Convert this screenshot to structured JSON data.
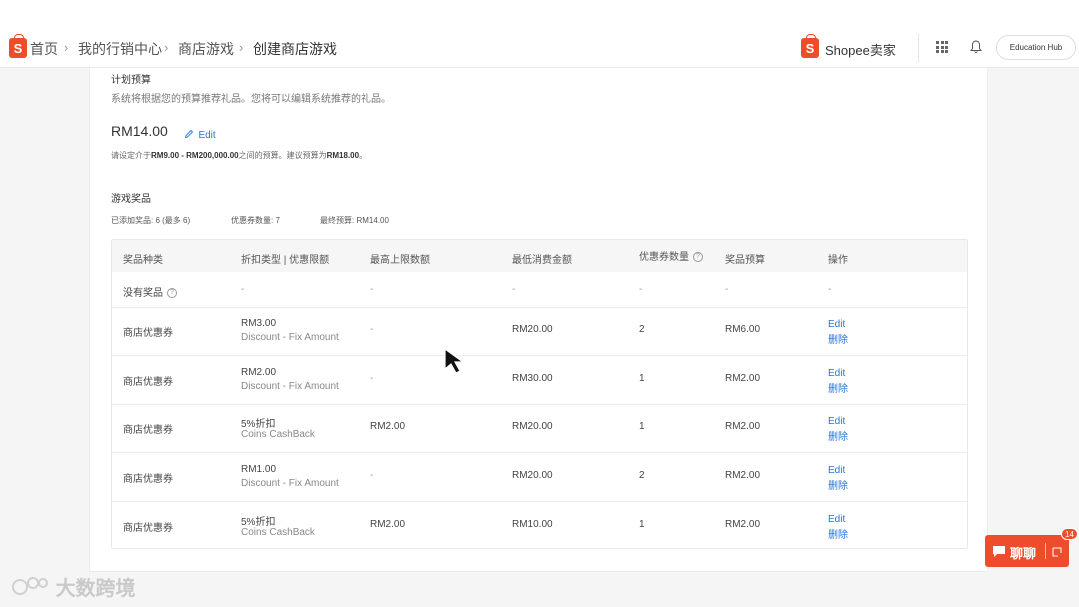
{
  "breadcrumb": {
    "items": [
      "首页",
      "我的行销中心",
      "商店游戏",
      "创建商店游戏"
    ]
  },
  "header": {
    "brand": "Shopee卖家",
    "education_hub": "Education Hub",
    "icons": [
      "apps-grid-icon",
      "bell-icon"
    ]
  },
  "budget_section": {
    "title": "计划预算",
    "description": "系统将根据您的预算推荐礼品。您将可以编辑系统推荐的礼品。",
    "amount": "RM14.00",
    "edit_label": "Edit",
    "note_prefix": "请设定介于",
    "note_min": "RM9.00",
    "note_mid": " - ",
    "note_max": "RM200,000.00",
    "note_middle": "之间的预算。建议预算为",
    "note_suggest": "RM18.00",
    "note_end": "。"
  },
  "prize_section": {
    "title": "游戏奖品",
    "added": "已添加奖品: 6 (最多 6)",
    "voucher_count": "优惠券数量: 7",
    "final_budget": "最终预算: RM14.00"
  },
  "table": {
    "headers": [
      "奖品种类",
      "折扣类型 | 优惠限额",
      "最高上限数额",
      "最低消费金额",
      "优惠券数量",
      "奖品预算",
      "操作"
    ],
    "rows": [
      {
        "type": "没有奖品",
        "discount": "-",
        "discount_sub": "",
        "max_cap": "-",
        "min_spend": "-",
        "qty": "-",
        "budget": "-",
        "action1": "-",
        "action2": ""
      },
      {
        "type": "商店优惠券",
        "discount": "RM3.00",
        "discount_sub": "Discount - Fix Amount",
        "max_cap": "-",
        "min_spend": "RM20.00",
        "qty": "2",
        "budget": "RM6.00",
        "action1": "Edit",
        "action2": "删除"
      },
      {
        "type": "商店优惠券",
        "discount": "RM2.00",
        "discount_sub": "Discount - Fix Amount",
        "max_cap": "-",
        "min_spend": "RM30.00",
        "qty": "1",
        "budget": "RM2.00",
        "action1": "Edit",
        "action2": "删除"
      },
      {
        "type": "商店优惠券",
        "discount": "5%折扣",
        "discount_sub": "Coins CashBack",
        "max_cap": "RM2.00",
        "min_spend": "RM20.00",
        "qty": "1",
        "budget": "RM2.00",
        "action1": "Edit",
        "action2": "删除"
      },
      {
        "type": "商店优惠券",
        "discount": "RM1.00",
        "discount_sub": "Discount - Fix Amount",
        "max_cap": "-",
        "min_spend": "RM20.00",
        "qty": "2",
        "budget": "RM2.00",
        "action1": "Edit",
        "action2": "删除"
      },
      {
        "type": "商店优惠券",
        "discount": "5%折扣",
        "discount_sub": "Coins CashBack",
        "max_cap": "RM2.00",
        "min_spend": "RM10.00",
        "qty": "1",
        "budget": "RM2.00",
        "action1": "Edit",
        "action2": "删除"
      }
    ]
  },
  "chat": {
    "label": "聊聊",
    "badge": "14"
  },
  "watermark": "大数跨境",
  "colors": {
    "brand": "#ee4d2d",
    "link": "#2673dd"
  }
}
